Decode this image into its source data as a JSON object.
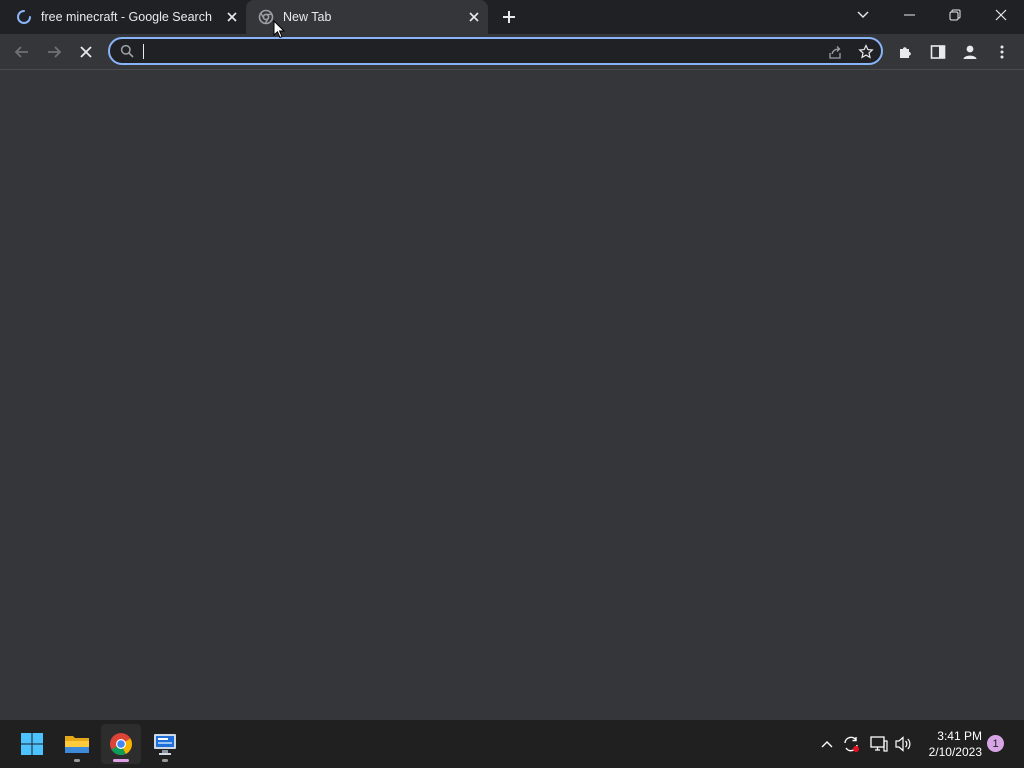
{
  "browser": {
    "tabs": [
      {
        "title": "free minecraft - Google Search",
        "state": "loading"
      },
      {
        "title": "New Tab",
        "state": "active"
      }
    ],
    "omnibox": {
      "value": "",
      "placeholder": ""
    },
    "accent": "#8ab4f8"
  },
  "taskbar": {
    "apps": [
      "start-icon",
      "file-explorer-icon",
      "chrome-icon",
      "remote-desktop-icon"
    ],
    "clock": {
      "time": "3:41 PM",
      "date": "2/10/2023"
    },
    "notification_count": "1"
  }
}
